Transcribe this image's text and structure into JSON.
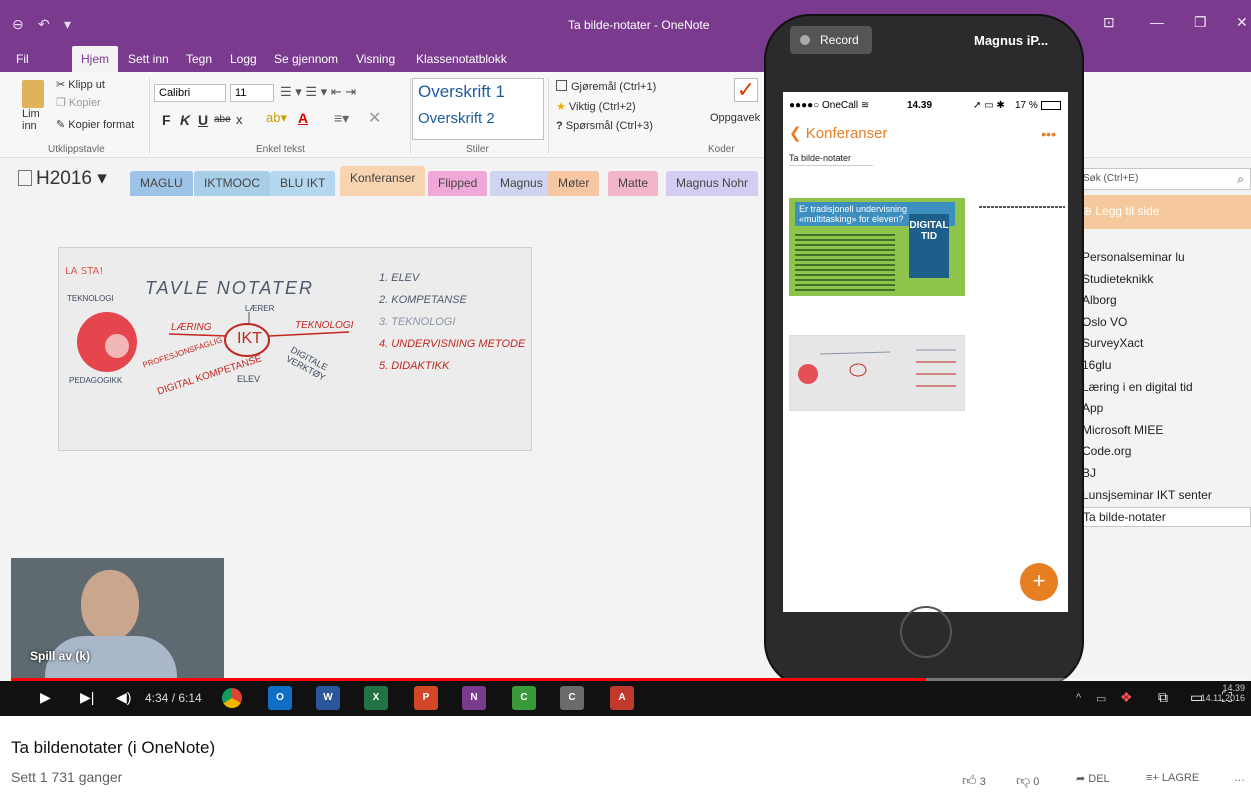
{
  "window": {
    "title": "Ta bilde-notater - OneNote",
    "ribbon_tabs": [
      "Fil",
      "Hjem",
      "Sett inn",
      "Tegn",
      "Logg",
      "Se gjennom",
      "Visning",
      "Klassenotatblokk"
    ]
  },
  "ribbon": {
    "clipboard": {
      "paste": "Lim inn",
      "cut": "Klipp ut",
      "copy": "Kopier",
      "format_painter": "Kopier format",
      "group": "Utklippstavle"
    },
    "basic_text": {
      "font": "Calibri",
      "size": "11",
      "bold": "F",
      "italic": "K",
      "underline": "U",
      "strike": "abe",
      "subscript": "x",
      "group": "Enkel tekst"
    },
    "styles": {
      "h1": "Overskrift 1",
      "h2": "Overskrift 2",
      "group": "Stiler"
    },
    "tags": {
      "todo": "Gjøremål (Ctrl+1)",
      "important": "Viktig (Ctrl+2)",
      "question": "Spørsmål (Ctrl+3)",
      "task": "Oppgavek",
      "group": "Koder"
    }
  },
  "notebook": {
    "name": "H2016",
    "sections": [
      {
        "label": "MAGLU",
        "color": "#9dc3e6"
      },
      {
        "label": "IKTMOOC",
        "color": "#a9cfe8"
      },
      {
        "label": "BLU IKT",
        "color": "#b4d6ee"
      },
      {
        "label": "Konferanser",
        "color": "#f8d5b0"
      },
      {
        "label": "Flipped",
        "color": "#f0a8d8"
      },
      {
        "label": "Magnus",
        "color": "#cdd5f0"
      },
      {
        "label": "Møter",
        "color": "#f6c7a2"
      },
      {
        "label": "Matte",
        "color": "#f3b6c8"
      },
      {
        "label": "Magnus Nohr",
        "color": "#d3cdf2"
      }
    ]
  },
  "pages": {
    "search_placeholder": "Søk (Ctrl+E)",
    "add_page": "Legg til side",
    "items": [
      "Personalseminar lu",
      "Studieteknikk",
      "Alborg",
      "Oslo VO",
      "SurveyXact",
      "16glu",
      "Læring i en digital tid",
      "App",
      "Microsoft MIEE",
      "Code.org",
      "BJ",
      "Lunsjseminar IKT senter",
      "Ta bilde-notater"
    ]
  },
  "whiteboard": {
    "label": "LA STA!",
    "title": "TAVLE NOTATER",
    "center": "IKT",
    "words": [
      "TEKNOLOGI",
      "LÆRER",
      "LÆRING",
      "TEKNOLOGI",
      "PROFESJONSFAGLIG",
      "DIGITAL KOMPETANSE",
      "ELEV",
      "DIGITALE VERKTØY",
      "PEDAGOGIKK"
    ],
    "list": [
      "1. ELEV",
      "2. KOMPETANSE",
      "3. TEKNOLOGI",
      "4. UNDERVISNING METODE",
      "5. DIDAKTIKK"
    ]
  },
  "phone": {
    "record_label": "Record",
    "device_name": "Magnus iP...",
    "carrier": "●●●●○ OneCall",
    "time": "14.39",
    "battery": "17 %",
    "back_label": "Konferanser",
    "page_title": "Ta bilde-notater",
    "slide_title": "Er tradisjonell undervisning «multitasking» for eleven?",
    "book_title": "DIGITAL TID",
    "fab": "+"
  },
  "player": {
    "overlay_label": "Spill av (k)",
    "time": "4:34 / 6:14",
    "progress": 0.74,
    "clock_time": "14.39",
    "clock_date": "14.11.2016",
    "taskbar_apps": [
      {
        "label": "O",
        "color": "#0f6fc6"
      },
      {
        "label": "W",
        "color": "#2b579a"
      },
      {
        "label": "X",
        "color": "#217346"
      },
      {
        "label": "P",
        "color": "#d24726"
      },
      {
        "label": "N",
        "color": "#7a3b8f"
      },
      {
        "label": "C",
        "color": "#3a9a3a"
      },
      {
        "label": "C",
        "color": "#6a6a6a"
      },
      {
        "label": "A",
        "color": "#c0392b"
      }
    ]
  },
  "video": {
    "title": "Ta bildenotater (i OneNote)",
    "views": "Sett 1 731 ganger",
    "likes": "3",
    "dislikes": "0",
    "share": "DEL",
    "save": "LAGRE"
  }
}
